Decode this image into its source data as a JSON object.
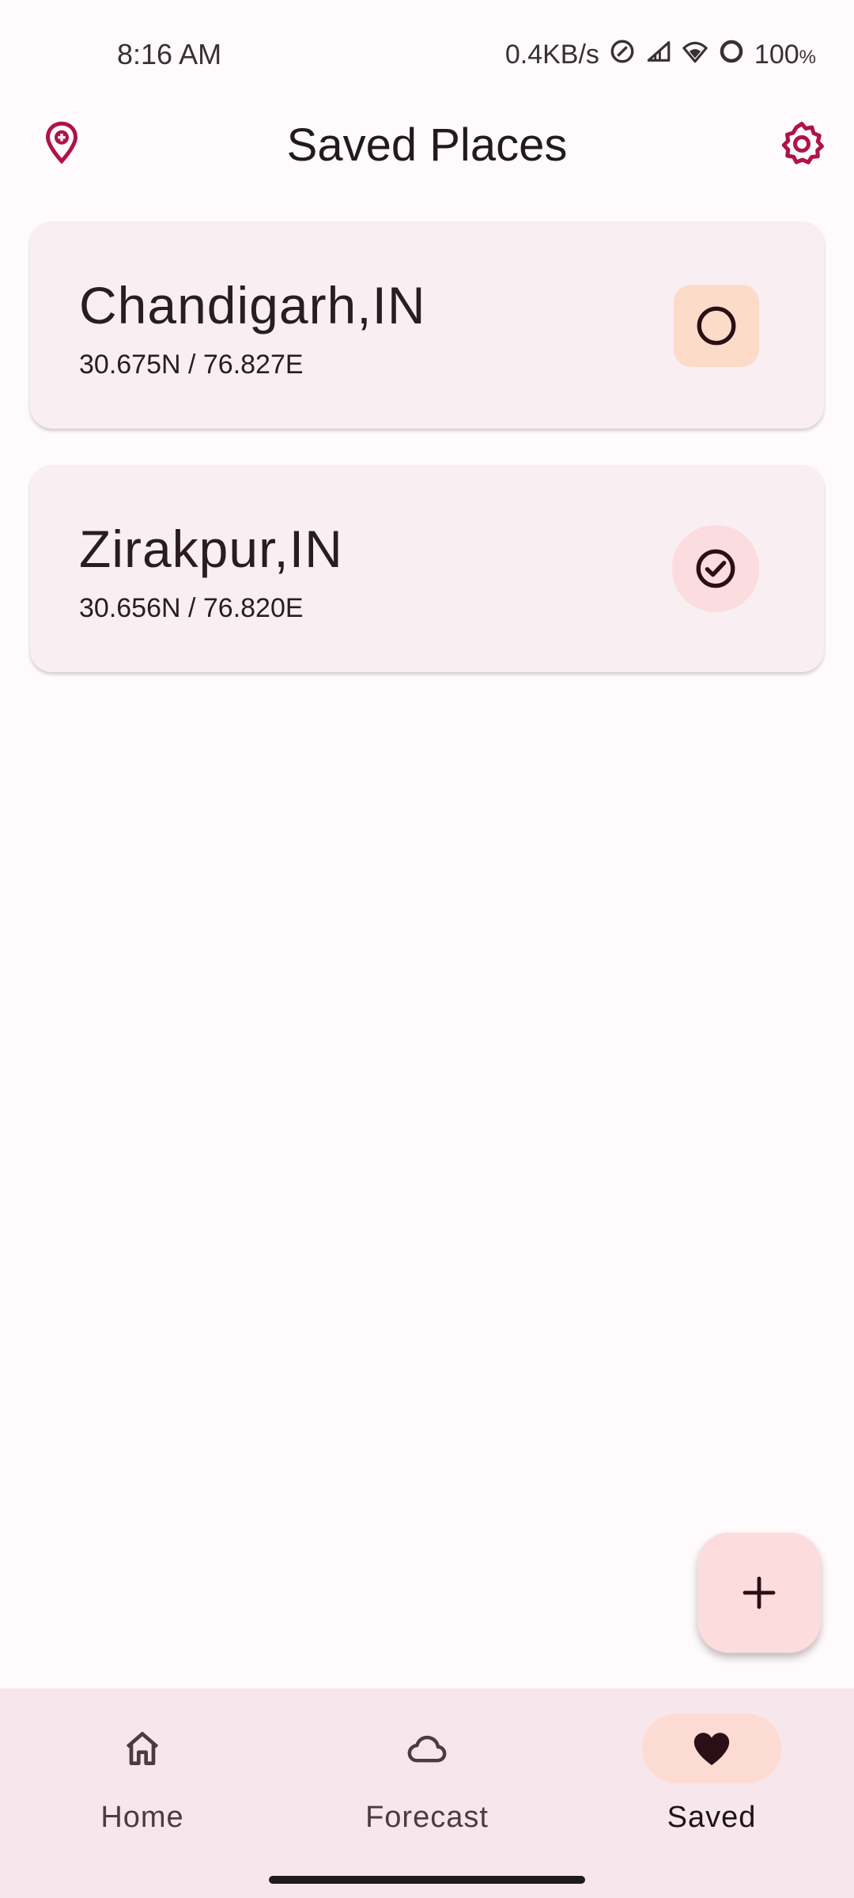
{
  "status_bar": {
    "time": "8:16 AM",
    "net_speed": "0.4KB/s",
    "battery": "100",
    "battery_unit": "%"
  },
  "app_bar": {
    "title": "Saved Places",
    "left_icon": "add-location-icon",
    "right_icon": "gear-icon"
  },
  "places": [
    {
      "name": "Chandigarh,IN",
      "coords": "30.675N / 76.827E",
      "selected": false,
      "icon": "radio-empty-circle-icon"
    },
    {
      "name": "Zirakpur,IN",
      "coords": "30.656N / 76.820E",
      "selected": true,
      "icon": "check-circle-icon"
    }
  ],
  "fab": {
    "icon": "plus-icon"
  },
  "nav": {
    "items": [
      {
        "label": "Home",
        "icon": "home-icon",
        "active": false
      },
      {
        "label": "Forecast",
        "icon": "cloud-icon",
        "active": false
      },
      {
        "label": "Saved",
        "icon": "heart-icon",
        "active": true
      }
    ]
  },
  "colors": {
    "accent": "#b0124a",
    "card_bg": "#f9eef2",
    "nav_bg": "#f7e6ec",
    "active_pill": "#fcdcd2",
    "fab_bg": "#fcdcdd"
  }
}
